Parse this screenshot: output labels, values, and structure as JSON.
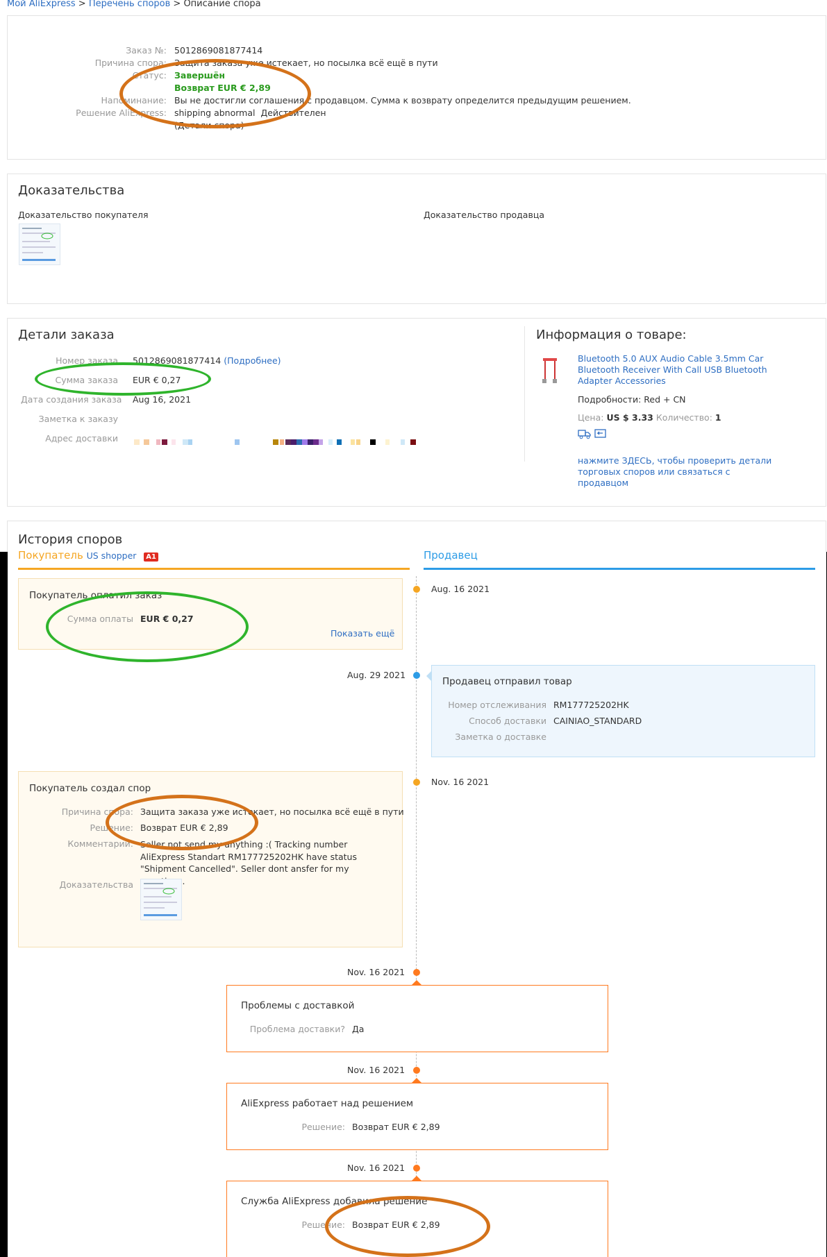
{
  "breadcrumb": {
    "home": "Мой AliExpress",
    "sep1": " > ",
    "list": "Перечень споров",
    "sep2": " > ",
    "current": "Описание спора"
  },
  "summary": {
    "order_no_label": "Заказ №:",
    "order_no": "5012869081877414",
    "reason_label": "Причина спора:",
    "reason": "Защита заказа уже истекает, но посылка всё ещё в пути",
    "status_label": "Статус:",
    "status": "Завершён",
    "refund": "Возврат EUR € 2,89",
    "reminder_label": "Напоминание:",
    "reminder": "Вы не достигли соглашения с продавцом. Сумма к возврату определится предыдущим решением.",
    "decision_label": "Решение AliExpress:",
    "decision": "shipping abnormal",
    "decision_valid": "Действителен",
    "details_link": "(Детали спора)"
  },
  "evidence": {
    "title": "Доказательства",
    "buyer_label": "Доказательство покупателя",
    "seller_label": "Доказательство продавца"
  },
  "order": {
    "title": "Детали заказа",
    "number_label": "Номер заказа",
    "number": "5012869081877414",
    "more_link": "(Подробнее)",
    "sum_label": "Сумма заказа",
    "sum": "EUR € 0,27",
    "date_label": "Дата создания заказа",
    "date": "Aug 16, 2021",
    "note_label": "Заметка к заказу",
    "address_label": "Адрес доставки"
  },
  "product": {
    "title": "Информация о товаре:",
    "name": "Bluetooth 5.0 AUX Audio Cable 3.5mm Car Bluetooth Receiver With Call USB Bluetooth Adapter Accessories",
    "details_label": "Подробности:",
    "details": "Red + CN",
    "price_label": "Цена:",
    "price": "US $ 3.33",
    "qty_label": "Количество:",
    "qty": "1",
    "icons": [
      "delivery-truck-icon",
      "return-icon"
    ],
    "contact_link": "нажмите ЗДЕСЬ, чтобы проверить детали торговых споров или связаться с продавцом"
  },
  "history": {
    "title": "История споров",
    "buyer_heading": "Покупатель",
    "buyer_name": "US shopper",
    "buyer_badge": "A1",
    "seller_heading": "Продавец",
    "events": [
      {
        "date": "Aug. 16 2021",
        "title": "Покупатель оплатил заказ",
        "pay_label": "Сумма оплаты",
        "pay": "EUR € 0,27",
        "more": "Показать ещё"
      },
      {
        "date": "Aug. 29 2021",
        "title": "Продавец отправил товар",
        "track_label": "Номер отслеживания",
        "track": "RM177725202HK",
        "method_label": "Способ доставки",
        "method": "CAINIAO_STANDARD",
        "note_label": "Заметка о доставке"
      },
      {
        "date": "Nov. 16 2021",
        "title": "Покупатель создал спор",
        "reason_label": "Причина спора:",
        "reason": "Защита заказа уже истекает, но посылка всё ещё в пути",
        "decision_label": "Решение:",
        "decision": "Возврат EUR € 2,89",
        "comment_label": "Комментарии:",
        "comment": "Seller not send my anything :( Tracking number AliExpress Standart RM177725202HK have status \"Shipment Cancelled\". Seller dont ansfer for my questions.",
        "evidence_label": "Доказательства"
      },
      {
        "date": "Nov. 16 2021",
        "title": "Проблемы с доставкой",
        "q_label": "Проблема доставки?",
        "q": "Да"
      },
      {
        "date": "Nov. 16 2021",
        "title": "AliExpress работает над решением",
        "decision_label": "Решение:",
        "decision": "Возврат EUR € 2,89"
      },
      {
        "date": "Nov. 16 2021",
        "title": "Служба AliExpress добавила решение",
        "decision_label": "Решение:",
        "decision": "Возврат EUR € 2,89"
      }
    ]
  },
  "colors": {
    "link": "#2e6ec2",
    "green": "#2a9b1e",
    "orange": "#ff7a1f",
    "buyer": "#f5a623",
    "seller": "#2d9ce6",
    "badge": "#e02b20"
  }
}
